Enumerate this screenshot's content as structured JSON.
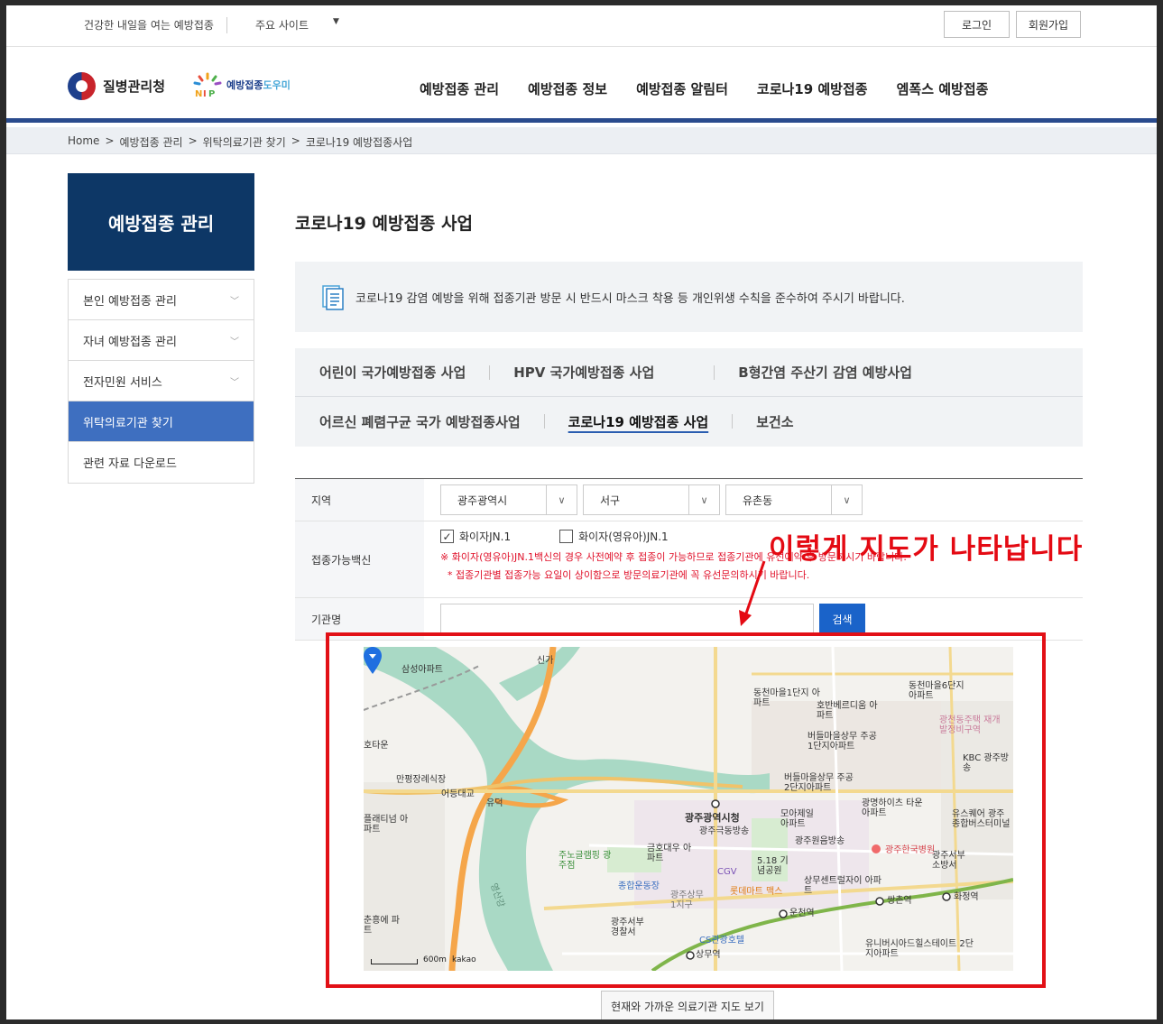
{
  "topbar": {
    "slogan": "건강한 내일을 여는 예방접종",
    "sites": "주요 사이트",
    "login": "로그인",
    "join": "회원가입"
  },
  "header": {
    "org": "질병관리청",
    "nip_main": "예방접종",
    "nip_sub": "도우미",
    "gnb": [
      "예방접종 관리",
      "예방접종 정보",
      "예방접종 알림터",
      "코로나19 예방접종",
      "엠폭스 예방접종"
    ]
  },
  "breadcrumb": [
    "Home",
    ">",
    "예방접종 관리",
    ">",
    "위탁의료기관 찾기",
    ">",
    "코로나19 예방접종사업"
  ],
  "sidebar": {
    "title": "예방접종 관리",
    "items": [
      {
        "label": "본인 예방접종 관리"
      },
      {
        "label": "자녀 예방접종 관리"
      },
      {
        "label": "전자민원 서비스"
      },
      {
        "label": "위탁의료기관 찾기"
      },
      {
        "label": "관련 자료 다운로드"
      }
    ]
  },
  "page": {
    "title": "코로나19 예방접종 사업",
    "notice": "코로나19 감염 예방을 위해 접종기관 방문 시 반드시 마스크 착용 등 개인위생 수칙을 준수하여 주시기 바랍니다."
  },
  "tabs": {
    "row1": [
      "어린이 국가예방접종 사업",
      "HPV 국가예방접종 사업",
      "B형간염 주산기 감염 예방사업"
    ],
    "row2": [
      "어르신 폐렴구균 국가 예방접종사업",
      "코로나19 예방접종 사업",
      "보건소"
    ]
  },
  "form": {
    "region_label": "지역",
    "region": [
      "광주광역시",
      "서구",
      "유촌동"
    ],
    "vaccine_label": "접종가능백신",
    "vaccine_options": [
      {
        "label": "화이자JN.1",
        "checked": true
      },
      {
        "label": "화이자(영유아)JN.1",
        "checked": false
      }
    ],
    "warn1": "※ 화이자(영유아)JN.1백신의 경우 사전예약 후 접종이 가능하므로 접종기관에 유선예약 후 방문하시기 바랍니다.",
    "warn2": "* 접종기관별 접종가능 요일이 상이함으로 방문의료기관에 꼭 유선문의하시기 바랍니다.",
    "name_label": "기관명",
    "name_value": "",
    "search": "검색"
  },
  "annotation": "이렇게 지도가 나타납니다",
  "map": {
    "labels": [
      "삼성아파트",
      "신가",
      "동천마을1단지 아파트",
      "호반베르디움 아파트",
      "동천마을6단지 아파트",
      "광천동주택 재개발정비구역",
      "KBC 광주방송",
      "버들마을상무 주공1단지아파트",
      "호타운",
      "만평장례식장",
      "어등대교",
      "유덕",
      "버들마을상무 주공2단지아파트",
      "광명하이츠 타운아파트",
      "유스퀘어 광주 종합버스터미널",
      "플래티넘 아파트",
      "광주광역시청",
      "광주극동방송",
      "모아제일 아파트",
      "광주원음방송",
      "광주한국병원",
      "광주서부 소방서",
      "주노글램핑 광주점",
      "금호대우 아파트",
      "CGV",
      "5.18 기념공원",
      "종합운동장",
      "상무센트럴자이 아파트",
      "롯데마트 맥스",
      "광주상무 1지구",
      "쌍촌역",
      "화정역",
      "운천역",
      "광주서부 경찰서",
      "CS관광호텔",
      "상무역",
      "춘흥에 파트",
      "유니버시아드힐스테이트 2단지아파트",
      "영산강"
    ],
    "scale": "600m",
    "brand": "kakao"
  },
  "nearby_button": "현재와 가까운 의료기관 지도 보기"
}
